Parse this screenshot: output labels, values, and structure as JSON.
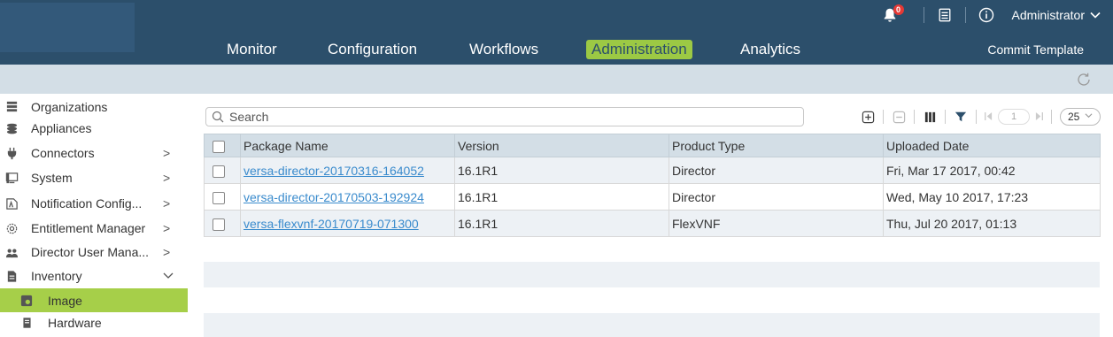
{
  "header": {
    "notification_count": "0",
    "user_label": "Administrator",
    "nav": [
      "Monitor",
      "Configuration",
      "Workflows",
      "Administration",
      "Analytics"
    ],
    "active_nav": "Administration",
    "commit_label": "Commit Template"
  },
  "sidebar": {
    "items": [
      {
        "label": "Organizations",
        "icon": "organizations-icon"
      },
      {
        "label": "Appliances",
        "icon": "appliances-icon"
      },
      {
        "label": "Connectors",
        "icon": "connectors-icon",
        "arrow": ">"
      },
      {
        "label": "System",
        "icon": "system-icon",
        "arrow": ">"
      },
      {
        "label": "Notification Config...",
        "icon": "notification-icon",
        "arrow": ">"
      },
      {
        "label": "Entitlement Manager",
        "icon": "entitlement-icon",
        "arrow": ">"
      },
      {
        "label": "Director User Mana...",
        "icon": "users-icon",
        "arrow": ">"
      },
      {
        "label": "Inventory",
        "icon": "inventory-icon",
        "arrow": "v"
      },
      {
        "label": "Image",
        "icon": "image-icon",
        "selected": true
      },
      {
        "label": "Hardware",
        "icon": "hardware-icon"
      }
    ]
  },
  "main": {
    "search_placeholder": "Search",
    "page_number": "1",
    "page_size": "25",
    "columns": [
      "Package Name",
      "Version",
      "Product Type",
      "Uploaded Date"
    ],
    "rows": [
      {
        "package": "versa-director-20170316-164052",
        "version": "16.1R1",
        "type": "Director",
        "date": "Fri, Mar 17 2017, 00:42"
      },
      {
        "package": "versa-director-20170503-192924",
        "version": "16.1R1",
        "type": "Director",
        "date": "Wed, May 10 2017, 17:23"
      },
      {
        "package": "versa-flexvnf-20170719-071300",
        "version": "16.1R1",
        "type": "FlexVNF",
        "date": "Thu, Jul 20 2017, 01:13"
      }
    ]
  },
  "colors": {
    "header_bg": "#2c4f6b",
    "accent_green": "#9cc944",
    "subbar_bg": "#d3dee6",
    "link": "#3a8bcd"
  }
}
